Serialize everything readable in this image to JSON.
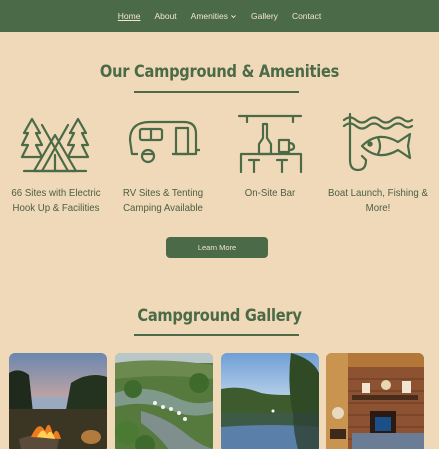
{
  "nav": {
    "items": [
      {
        "label": "Home",
        "active": true
      },
      {
        "label": "About"
      },
      {
        "label": "Amenities",
        "has_dropdown": true
      },
      {
        "label": "Gallery"
      },
      {
        "label": "Contact"
      }
    ]
  },
  "amenities_section": {
    "title": "Our Campground & Amenities",
    "items": [
      {
        "icon": "tent-camp-icon",
        "line1": "66 Sites with Electric",
        "line2": "Hook Up & Facilities"
      },
      {
        "icon": "rv-camper-icon",
        "line1": "RV Sites & Tenting",
        "line2": "Camping Available"
      },
      {
        "icon": "bar-counter-icon",
        "line1": "On-Site Bar",
        "line2": ""
      },
      {
        "icon": "fishing-hook-fish-icon",
        "line1": "Boat Launch, Fishing &",
        "line2": "More!"
      }
    ],
    "button_label": "Learn More"
  },
  "gallery_section": {
    "title": "Campground Gallery",
    "photos": [
      {
        "name": "campfire-by-lake-photo"
      },
      {
        "name": "aerial-marina-photo"
      },
      {
        "name": "lake-reflection-photo"
      },
      {
        "name": "lodge-interior-photo"
      }
    ]
  },
  "colors": {
    "brand_green": "#4b6a47",
    "background": "#f0d9b8",
    "nav_text": "#f3e6d0"
  }
}
